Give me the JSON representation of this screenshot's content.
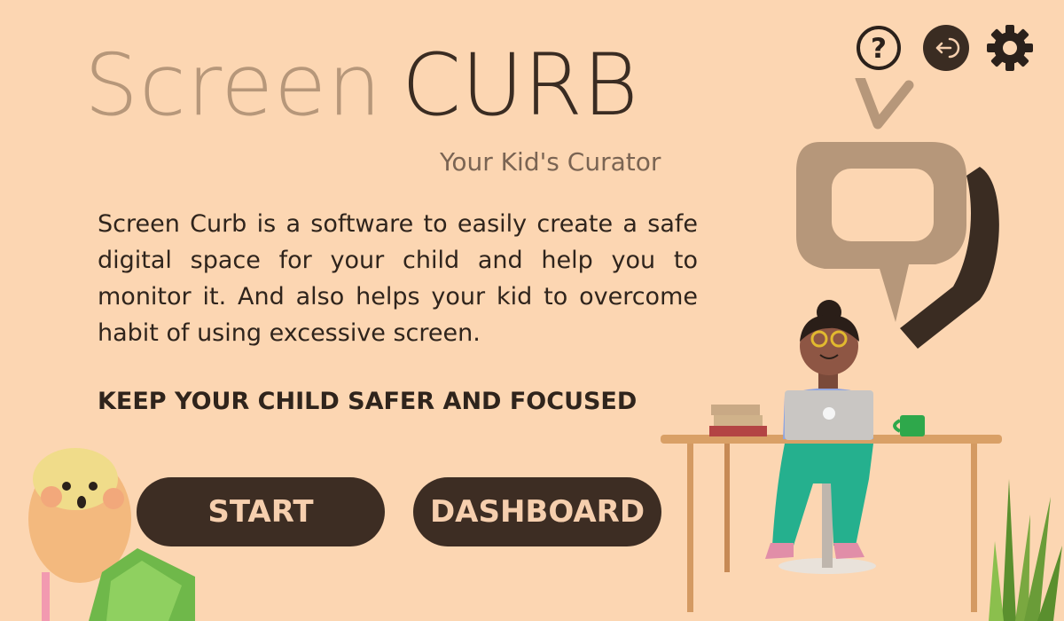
{
  "app": {
    "title_part1": "Screen",
    "title_part2": "CURB",
    "tagline": "Your Kid's Curator"
  },
  "main": {
    "description": "Screen Curb is a software to easily create a safe digital space for your child and help you to monitor it. And also helps your kid to overcome habit of using excessive screen.",
    "headline": "KEEP YOUR CHILD SAFER AND FOCUSED"
  },
  "actions": {
    "start_label": "START",
    "dashboard_label": "DASHBOARD"
  },
  "toolbar": {
    "help_icon": "question-circle",
    "help_glyph": "?",
    "logout_icon": "logout-arrow",
    "settings_icon": "gear"
  },
  "colors": {
    "background": "#fcd6b2",
    "button_bg": "#3d2d23",
    "button_text": "#f6cfae",
    "title_light": "#b6977a",
    "title_dark": "#3a2c22"
  }
}
